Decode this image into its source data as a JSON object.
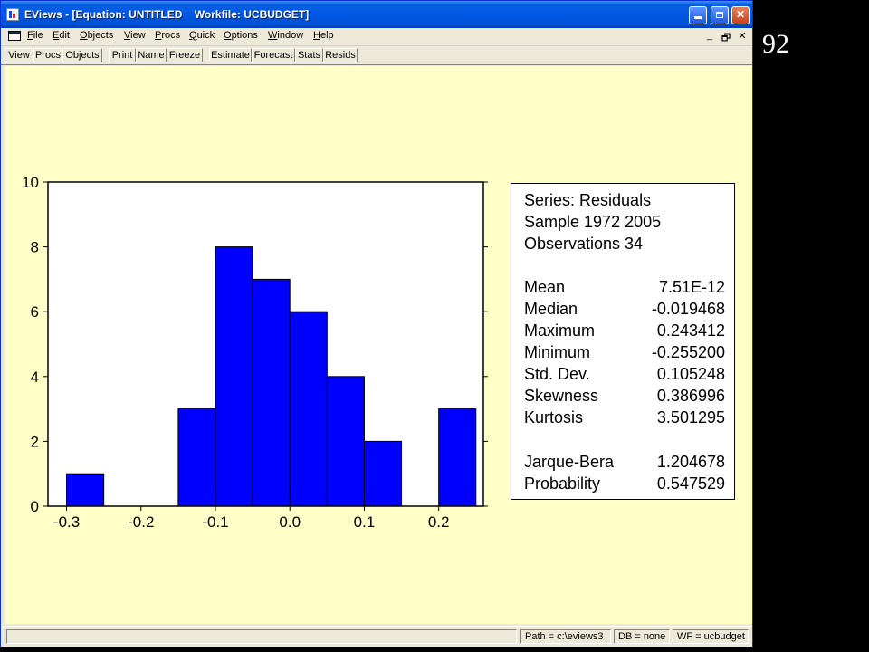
{
  "window": {
    "title": "EViews - [Equation: UNTITLED    Workfile: UCBUDGET]",
    "minimize": "",
    "maximize": "",
    "close": "✕"
  },
  "menu": {
    "items": [
      {
        "first": "F",
        "rest": "ile"
      },
      {
        "first": "E",
        "rest": "dit"
      },
      {
        "first": "O",
        "rest": "bjects"
      },
      {
        "first": "V",
        "rest": "iew"
      },
      {
        "first": "P",
        "rest": "rocs"
      },
      {
        "first": "Q",
        "rest": "uick"
      },
      {
        "first": "O",
        "rest": "ptions"
      },
      {
        "first": "W",
        "rest": "indow"
      },
      {
        "first": "H",
        "rest": "elp"
      }
    ],
    "doc_minimize": "_",
    "doc_restore": "🗗",
    "doc_close": "✕"
  },
  "toolbar": {
    "buttons": [
      "View",
      "Procs",
      "Objects",
      "Print",
      "Name",
      "Freeze",
      "Estimate",
      "Forecast",
      "Stats",
      "Resids"
    ]
  },
  "chart_data": {
    "type": "bar",
    "bins": [
      {
        "from": -0.3,
        "to": -0.25,
        "count": 1
      },
      {
        "from": -0.25,
        "to": -0.2,
        "count": 0
      },
      {
        "from": -0.2,
        "to": -0.15,
        "count": 0
      },
      {
        "from": -0.15,
        "to": -0.1,
        "count": 3
      },
      {
        "from": -0.1,
        "to": -0.05,
        "count": 8
      },
      {
        "from": -0.05,
        "to": 0.0,
        "count": 7
      },
      {
        "from": 0.0,
        "to": 0.05,
        "count": 6
      },
      {
        "from": 0.05,
        "to": 0.1,
        "count": 4
      },
      {
        "from": 0.1,
        "to": 0.15,
        "count": 2
      },
      {
        "from": 0.15,
        "to": 0.2,
        "count": 0
      },
      {
        "from": 0.2,
        "to": 0.25,
        "count": 3
      }
    ],
    "x_ticks": [
      -0.3,
      -0.2,
      -0.1,
      0.0,
      0.1,
      0.2
    ],
    "x_tick_labels": [
      "-0.3",
      "-0.2",
      "-0.1",
      "0.0",
      "0.1",
      "0.2"
    ],
    "xlim": [
      -0.325,
      0.26
    ],
    "y_ticks": [
      0,
      2,
      4,
      6,
      8,
      10
    ],
    "y_tick_labels": [
      "0",
      "2",
      "4",
      "6",
      "8",
      "10"
    ],
    "ylim": [
      0,
      10
    ],
    "bar_color": "#0000ff",
    "grid": false,
    "title": "",
    "xlabel": "",
    "ylabel": ""
  },
  "stats": {
    "series": "Series: Residuals",
    "sample": "Sample 1972 2005",
    "observations": "Observations 34",
    "descriptive": [
      {
        "label": "Mean",
        "value": "7.51E-12"
      },
      {
        "label": "Median",
        "value": "-0.019468"
      },
      {
        "label": "Maximum",
        "value": "0.243412"
      },
      {
        "label": "Minimum",
        "value": "-0.255200"
      },
      {
        "label": "Std. Dev.",
        "value": "0.105248"
      },
      {
        "label": "Skewness",
        "value": "0.386996"
      },
      {
        "label": "Kurtosis",
        "value": "3.501295"
      }
    ],
    "tests": [
      {
        "label": "Jarque-Bera",
        "value": "1.204678"
      },
      {
        "label": "Probability",
        "value": "0.547529"
      }
    ]
  },
  "statusbar": {
    "path": "Path = c:\\eviews3",
    "db": "DB = none",
    "wf": "WF = ucbudget"
  },
  "slide": {
    "page_number": "92"
  },
  "colors": {
    "title_bar": "#0058e6",
    "content_bg": "#ffffc8",
    "bars": "#0000ff"
  }
}
